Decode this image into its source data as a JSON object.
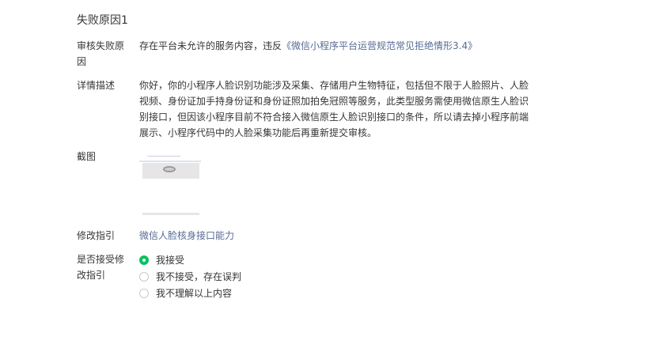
{
  "section_title": "失败原因1",
  "reason": {
    "label": "审核失败原因",
    "text": "存在平台未允许的服务内容，违反",
    "link": "《微信小程序平台运营规范常见拒绝情形3.4》"
  },
  "detail": {
    "label": "详情描述",
    "text": "你好，你的小程序人脸识别功能涉及采集、存储用户生物特征，包括但不限于人脸照片、人脸视频、身份证加手持身份证和身份证照加拍免冠照等服务，此类型服务需使用微信原生人脸识别接口，但因该小程序目前不符合接入微信原生人脸识别接口的条件，所以请去掉小程序前端展示、小程序代码中的人脸采集功能后再重新提交审核。"
  },
  "screenshot": {
    "label": "截图"
  },
  "guide": {
    "label": "修改指引",
    "link": "微信人脸核身接口能力"
  },
  "accept": {
    "label": "是否接受修改指引",
    "options": [
      {
        "label": "我接受",
        "checked": true
      },
      {
        "label": "我不接受，存在误判",
        "checked": false
      },
      {
        "label": "我不理解以上内容",
        "checked": false
      }
    ]
  },
  "colors": {
    "link": "#576b95",
    "radio_checked": "#07c160",
    "text": "#353535"
  }
}
